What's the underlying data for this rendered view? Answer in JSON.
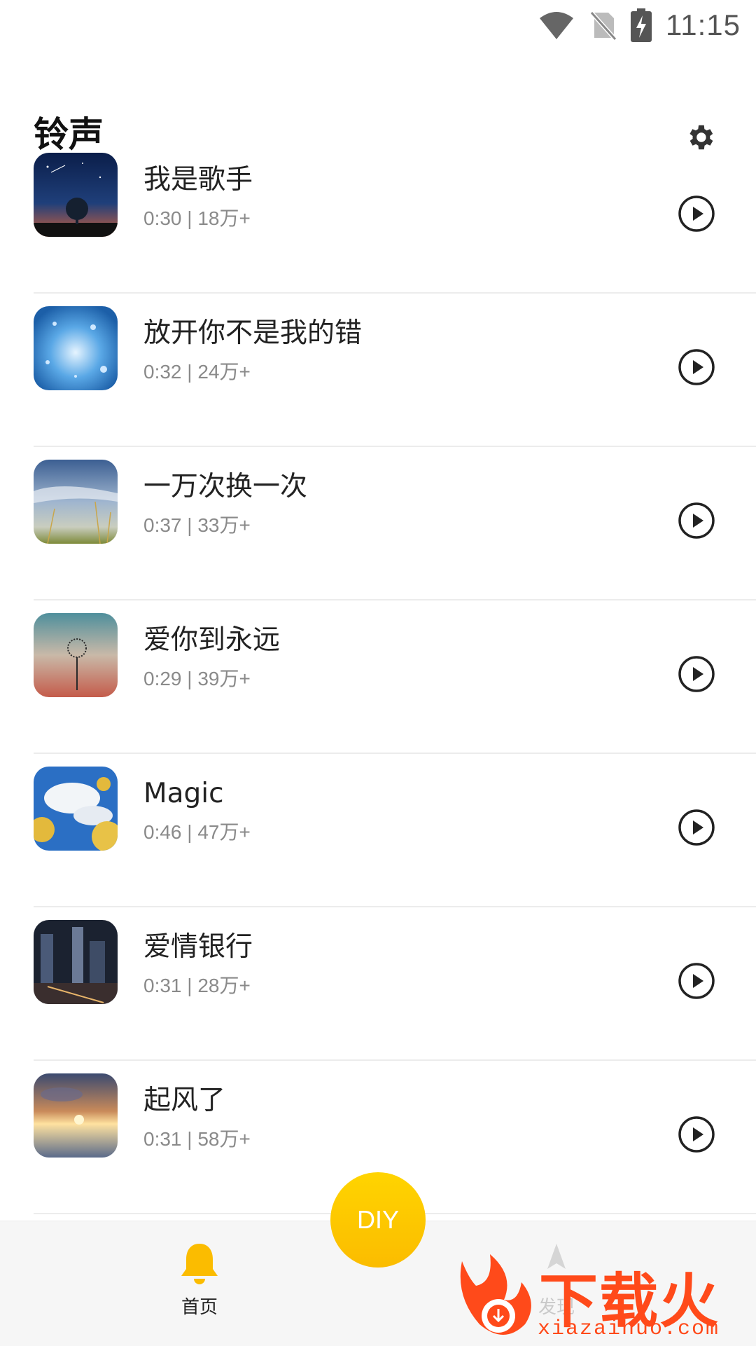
{
  "status_bar": {
    "time": "11:15"
  },
  "header": {
    "title": "铃声"
  },
  "items": [
    {
      "title": "我是歌手",
      "meta": "0:30 | 18万+"
    },
    {
      "title": "放开你不是我的错",
      "meta": "0:32 | 24万+"
    },
    {
      "title": "一万次换一次",
      "meta": "0:37 | 33万+"
    },
    {
      "title": "爱你到永远",
      "meta": "0:29 | 39万+"
    },
    {
      "title": "Magic",
      "meta": "0:46 | 47万+"
    },
    {
      "title": "爱情银行",
      "meta": "0:31 | 28万+"
    },
    {
      "title": "起风了",
      "meta": "0:31 | 58万+"
    }
  ],
  "bottom_nav": {
    "home_label": "首页",
    "discover_label": "发现",
    "diy_label": "DIY"
  },
  "watermark": {
    "brand": "下载火",
    "url": "xiazaihuo.com"
  },
  "colors": {
    "accent": "#fbbc00",
    "watermark": "#ff4a1a"
  }
}
